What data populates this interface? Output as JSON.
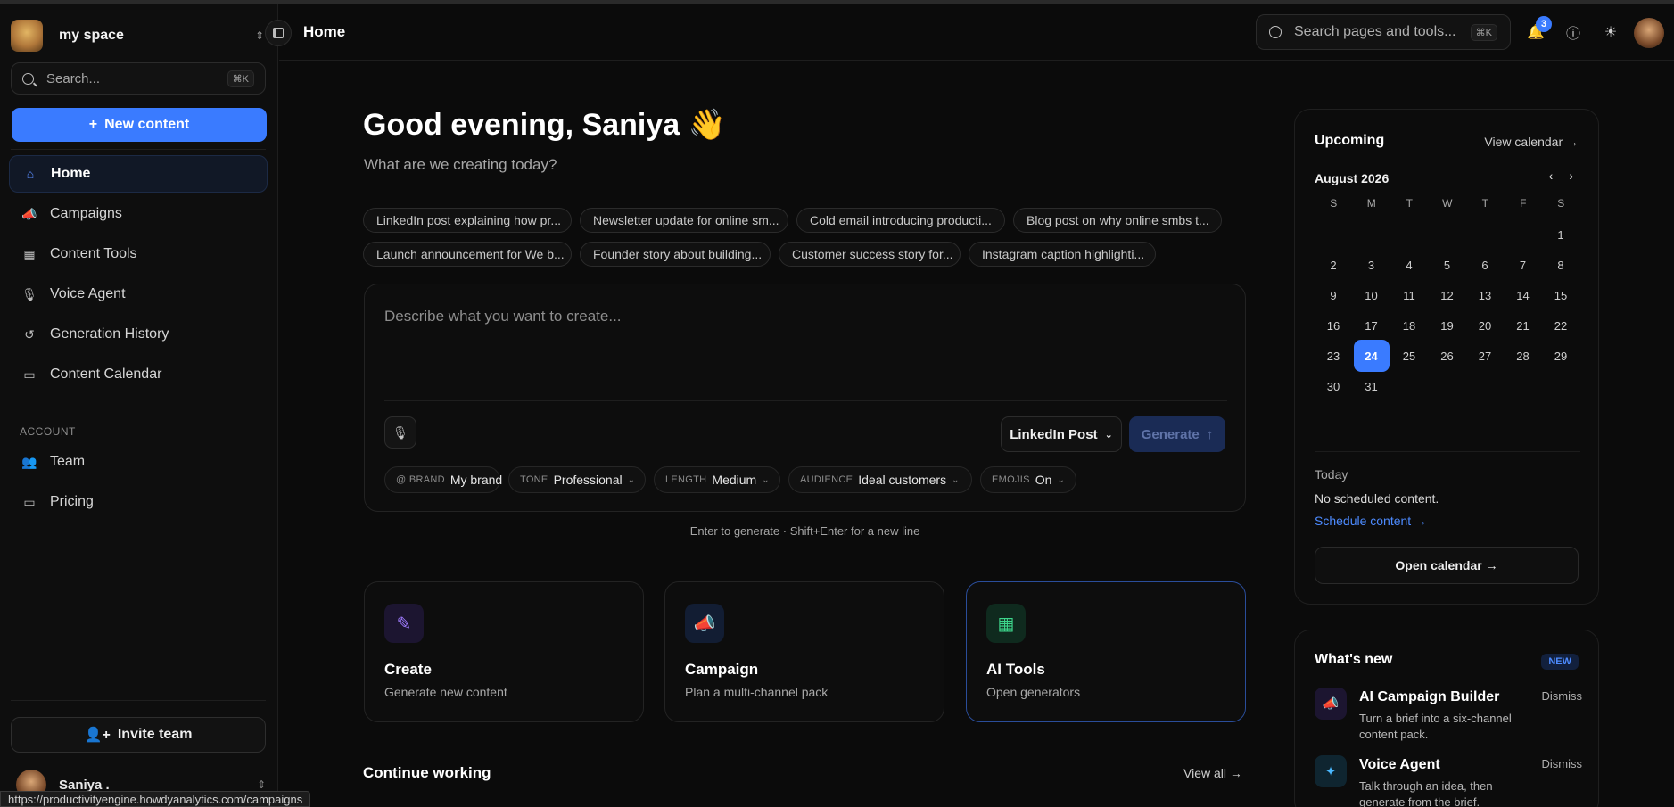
{
  "sidebar": {
    "workspace_name": "my space",
    "search_placeholder": "Search...",
    "search_shortcut": "⌘K",
    "new_content_label": "New content",
    "nav": [
      {
        "label": "Home",
        "icon": "home-icon"
      },
      {
        "label": "Campaigns",
        "icon": "megaphone-icon"
      },
      {
        "label": "Content Tools",
        "icon": "grid-icon"
      },
      {
        "label": "Voice Agent",
        "icon": "mic-icon"
      },
      {
        "label": "Generation History",
        "icon": "history-icon"
      },
      {
        "label": "Content Calendar",
        "icon": "calendar-icon"
      }
    ],
    "account_heading": "ACCOUNT",
    "account_nav": [
      {
        "label": "Team",
        "icon": "team-icon"
      },
      {
        "label": "Pricing",
        "icon": "card-icon"
      }
    ],
    "invite_label": "Invite team",
    "user_name": "Saniya ."
  },
  "status_url": "https://productivityengine.howdyanalytics.com/campaigns",
  "header": {
    "title": "Home",
    "search_placeholder": "Search pages and tools...",
    "search_shortcut": "⌘K",
    "notification_count": "3"
  },
  "main": {
    "greeting": "Good evening, Saniya 👋",
    "subtitle": "What are we creating today?",
    "suggestions": [
      "LinkedIn post explaining how pr...",
      "Newsletter update for online sm...",
      "Cold email introducing producti...",
      "Blog post on why online smbs t...",
      "Launch announcement for We b...",
      "Founder story about building...",
      "Customer success story for...",
      "Instagram caption highlighti..."
    ],
    "composer": {
      "placeholder": "Describe what you want to create...",
      "post_type": "LinkedIn Post",
      "generate_label": "Generate",
      "options": [
        {
          "key": "@ BRAND",
          "value": "My brand"
        },
        {
          "key": "TONE",
          "value": "Professional"
        },
        {
          "key": "LENGTH",
          "value": "Medium"
        },
        {
          "key": "AUDIENCE",
          "value": "Ideal customers"
        },
        {
          "key": "EMOJIS",
          "value": "On"
        }
      ]
    },
    "hint": "Enter to generate · Shift+Enter for a new line",
    "cards": [
      {
        "title": "Create",
        "desc": "Generate new content",
        "icon": "pen-icon",
        "color": "#a07cff"
      },
      {
        "title": "Campaign",
        "desc": "Plan a multi-channel pack",
        "icon": "megaphone-icon",
        "color": "#5b8dff"
      },
      {
        "title": "AI Tools",
        "desc": "Open generators",
        "icon": "grid-icon",
        "color": "#3dd68c"
      }
    ],
    "continue_title": "Continue working",
    "view_all": "View all →"
  },
  "upcoming": {
    "title": "Upcoming",
    "view_calendar": "View calendar →",
    "month": "August 2026",
    "weekdays": [
      "S",
      "M",
      "T",
      "W",
      "T",
      "F",
      "S"
    ],
    "today_day": "24",
    "today_label": "Today",
    "no_content": "No scheduled content.",
    "schedule_link": "Schedule content →",
    "open_calendar": "Open calendar →"
  },
  "whats_new": {
    "title": "What's new",
    "badge": "NEW",
    "items": [
      {
        "title": "AI Campaign Builder",
        "desc": "Turn a brief into a six-channel content pack.",
        "dismiss": "Dismiss",
        "icon": "megaphone-icon"
      },
      {
        "title": "Voice Agent",
        "desc": "Talk through an idea, then generate from the brief.",
        "dismiss": "Dismiss",
        "icon": "sparkle-icon"
      }
    ]
  },
  "colors": {
    "accent": "#3a7bff",
    "background": "#0b0b0b"
  }
}
